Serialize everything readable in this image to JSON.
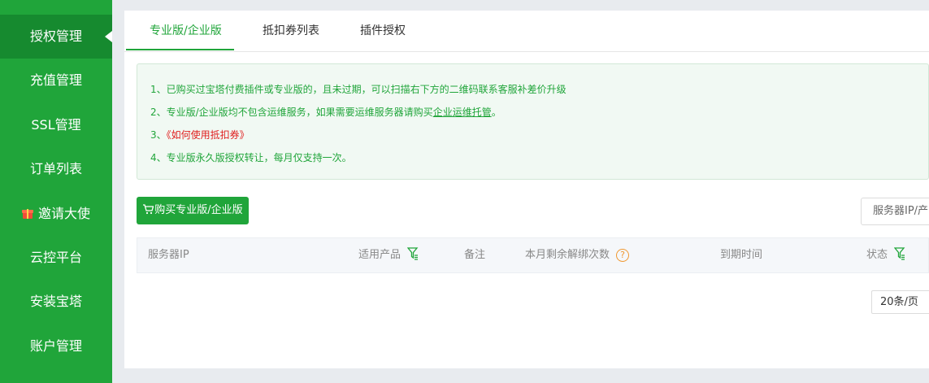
{
  "sidebar": {
    "items": [
      {
        "label": "授权管理",
        "active": true
      },
      {
        "label": "充值管理"
      },
      {
        "label": "SSL管理"
      },
      {
        "label": "订单列表"
      },
      {
        "label": "邀请大使",
        "icon": "gift-icon"
      },
      {
        "label": "云控平台"
      },
      {
        "label": "安装宝塔"
      },
      {
        "label": "账户管理"
      }
    ]
  },
  "tabs": [
    {
      "label": "专业版/企业版",
      "active": true
    },
    {
      "label": "抵扣券列表"
    },
    {
      "label": "插件授权"
    }
  ],
  "notice": {
    "line1": "1、已购买过宝塔付费插件或专业版的，且未过期，可以扫描右下方的二维码联系客服补差价升级",
    "line2_text": "2、专业版/企业版均不包含运维服务，如果需要运维服务器请购买",
    "line2_link": "企业运维托管",
    "line2_end": "。",
    "line3_prefix": "3、",
    "line3_link": "《如何使用抵扣券》",
    "line4": "4、专业版永久版授权转让，每月仅支持一次。"
  },
  "buy_button": {
    "label": "购买专业版/企业版",
    "icon": "cart-icon"
  },
  "search": {
    "placeholder": "服务器IP/产"
  },
  "table": {
    "columns": [
      {
        "label": "服务器IP"
      },
      {
        "label": "适用产品",
        "icon": "filter-icon"
      },
      {
        "label": "备注"
      },
      {
        "label": "本月剩余解绑次数",
        "icon": "help-icon"
      },
      {
        "label": "到期时间"
      },
      {
        "label": "状态",
        "icon": "filter-icon"
      }
    ]
  },
  "pagination": {
    "page_size": "20条/页"
  },
  "colors": {
    "accent": "#20a53a",
    "sidebar_active": "#168a2f",
    "link_red": "#e02020",
    "help_orange": "#f09830"
  }
}
